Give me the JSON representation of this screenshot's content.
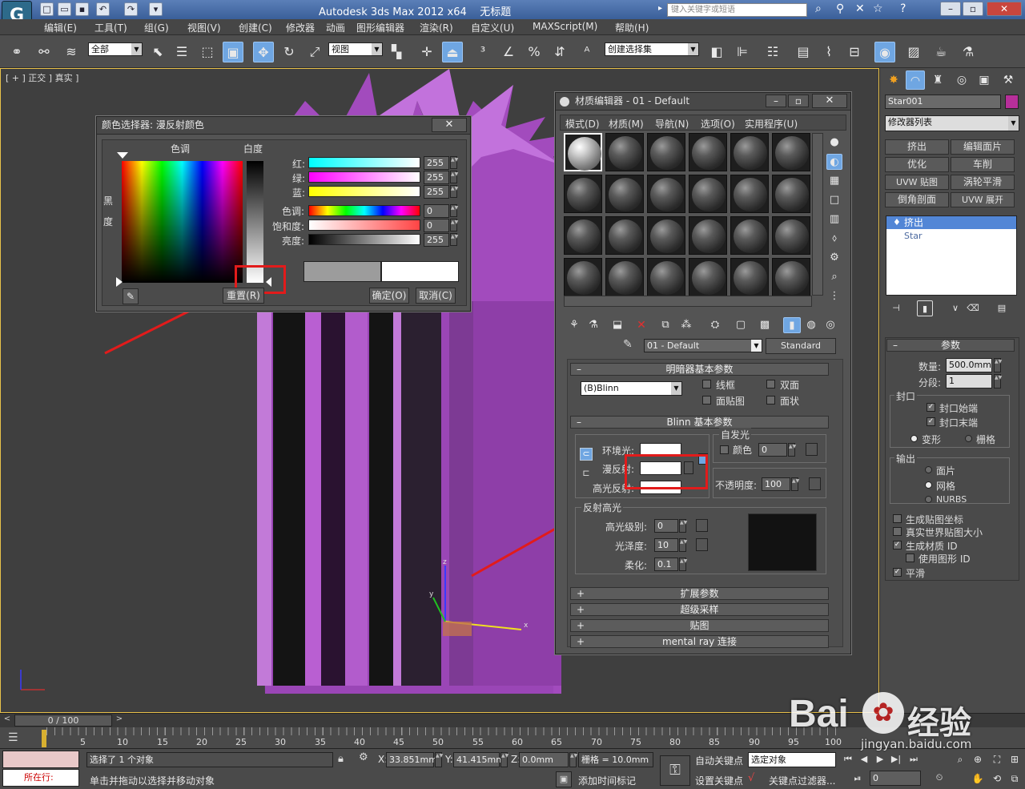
{
  "app": {
    "title": "Autodesk 3ds Max  2012 x64",
    "file": "无标题",
    "search_placeholder": "键入关键字或短语"
  },
  "menu": [
    "编辑(E)",
    "工具(T)",
    "组(G)",
    "视图(V)",
    "创建(C)",
    "修改器",
    "动画",
    "图形编辑器",
    "渲染(R)",
    "自定义(U)",
    "MAXScript(M)",
    "帮助(H)"
  ],
  "toolbar": {
    "filter": "全部",
    "coord": "视图",
    "selset": "创建选择集"
  },
  "viewport": {
    "label": "[ + ] 正交 ] 真实 ]"
  },
  "color_picker": {
    "title": "颜色选择器: 漫反射颜色",
    "hue_label": "色调",
    "white_label": "白度",
    "black_label_1": "黑",
    "black_label_2": "度",
    "red_label": "红:",
    "green_label": "绿:",
    "blue_label": "蓝:",
    "hue2_label": "色调:",
    "sat_label": "饱和度:",
    "val_label": "亮度:",
    "red": "255",
    "green": "255",
    "blue": "255",
    "hue": "0",
    "sat": "0",
    "val": "255",
    "reset": "重置(R)",
    "ok": "确定(O)",
    "cancel": "取消(C)",
    "close": "✕"
  },
  "mat_editor": {
    "title": "材质编辑器 - 01 - Default",
    "menu": [
      "模式(D)",
      "材质(M)",
      "导航(N)",
      "选项(O)",
      "实用程序(U)"
    ],
    "material_name": "01 - Default",
    "material_type": "Standard",
    "shader_rollout": "明暗器基本参数",
    "shader": "(B)Blinn",
    "wire": "线框",
    "two_sided": "双面",
    "face_map": "面贴图",
    "faceted": "面状",
    "blinn_rollout": "Blinn 基本参数",
    "self_illum": "自发光",
    "color": "颜色",
    "self_illum_val": "0",
    "ambient": "环境光:",
    "diffuse": "漫反射:",
    "specular": "高光反射:",
    "opacity": "不透明度:",
    "opacity_val": "100",
    "spec_highlights": "反射高光",
    "spec_level": "高光级别:",
    "spec_level_val": "0",
    "glossiness": "光泽度:",
    "glossiness_val": "10",
    "soften": "柔化:",
    "soften_val": "0.1",
    "rollouts": [
      "扩展参数",
      "超级采样",
      "贴图",
      "mental ray 连接"
    ]
  },
  "command_panel": {
    "object_name": "Star001",
    "modifier_list": "修改器列表",
    "buttons": [
      "挤出",
      "编辑面片",
      "优化",
      "车削",
      "UVW 贴图",
      "涡轮平滑",
      "倒角剖面",
      "UVW 展开"
    ],
    "stack": [
      "挤出",
      "Star"
    ],
    "params_title": "参数",
    "amount_label": "数量:",
    "amount": "500.0mm",
    "segments_label": "分段:",
    "segments": "1",
    "capping": "封口",
    "cap_start": "封口始端",
    "cap_end": "封口末端",
    "morph": "变形",
    "grid": "栅格",
    "output": "输出",
    "patch": "面片",
    "mesh": "网格",
    "nurbs": "NURBS",
    "gen_map": "生成贴图坐标",
    "real_world": "真实世界贴图大小",
    "gen_mat_id": "生成材质 ID",
    "use_shape_id": "使用图形 ID",
    "smooth": "平滑"
  },
  "timeline": {
    "frame": "0 / 100",
    "ticks": [
      "0",
      "5",
      "10",
      "15",
      "20",
      "25",
      "30",
      "35",
      "40",
      "45",
      "50",
      "55",
      "60",
      "65",
      "70",
      "75",
      "80",
      "85",
      "90",
      "95",
      "100"
    ]
  },
  "status": {
    "selected": "选择了 1 个对象",
    "prompt": "单击并拖动以选择并移动对象",
    "running": "所在行:",
    "x_label": "X:",
    "x": "33.851mm",
    "y_label": "Y:",
    "y": "41.415mm",
    "z_label": "Z:",
    "z": "0.0mm",
    "grid": "栅格 = 10.0mm",
    "auto_key": "自动关键点",
    "sel_obj": "选定对象",
    "set_key": "设置关键点",
    "key_filter": "关键点过滤器...",
    "add_time_tag": "添加时间标记",
    "frame_field": "0"
  },
  "watermark": {
    "brand": "Bai",
    "brand2": "经验",
    "url": "jingyan.baidu.com"
  },
  "colors": {
    "accent": "#6fa6e2",
    "object": "#b050c8",
    "highlight": "#e21b1b"
  }
}
